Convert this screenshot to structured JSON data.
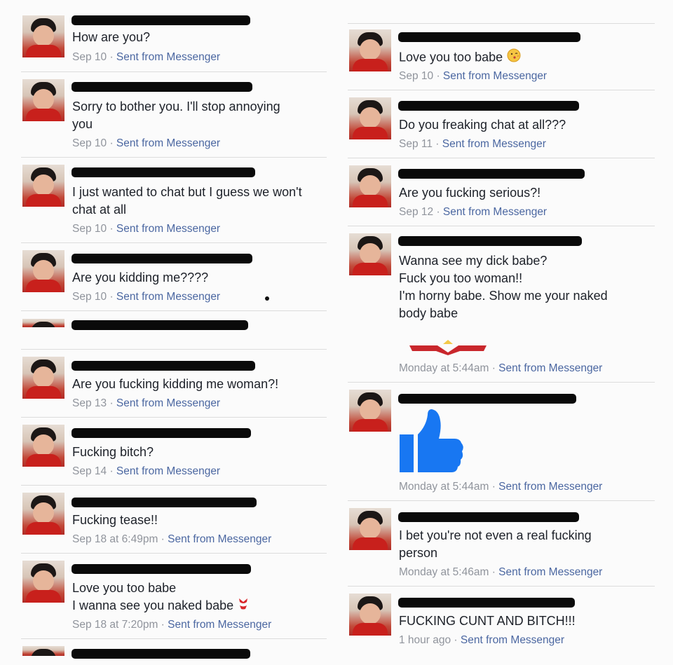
{
  "messages_left": [
    {
      "text": "How are you?",
      "date": "Sep 10",
      "sent_label": "Sent from Messenger"
    },
    {
      "text_lines": [
        "Sorry to bother you. I'll stop annoying",
        "you"
      ],
      "date": "Sep 10",
      "sent_label": "Sent from Messenger"
    },
    {
      "text_lines": [
        "I just wanted to chat but I guess we won't",
        "chat at all"
      ],
      "date": "Sep 10",
      "sent_label": "Sent from Messenger"
    },
    {
      "text": "Are you kidding me????",
      "date": "Sep 10",
      "sent_label": "Sent from Messenger"
    },
    {
      "text": "",
      "date": "",
      "sent_label": ""
    },
    {
      "text": "Are you fucking kidding me woman?!",
      "date": "Sep 13",
      "sent_label": "Sent from Messenger"
    },
    {
      "text": "Fucking bitch?",
      "date": "Sep 14",
      "sent_label": "Sent from Messenger"
    },
    {
      "text": "Fucking tease!!",
      "date": "Sep 18 at 6:49pm",
      "sent_label": "Sent from Messenger"
    },
    {
      "text_lines": [
        "Love you too babe",
        "I wanna see you naked babe"
      ],
      "date": "Sep 18 at 7:20pm",
      "sent_label": "Sent from Messenger",
      "emoji": "bikini-icon"
    }
  ],
  "messages_right": [
    {
      "text": "Love you too babe",
      "date": "Sep 10",
      "sent_label": "Sent from Messenger",
      "emoji": "kiss-face-icon"
    },
    {
      "text": "Do you freaking chat at all???",
      "date": "Sep 11",
      "sent_label": "Sent from Messenger"
    },
    {
      "text": "Are you fucking serious?!",
      "date": "Sep 12",
      "sent_label": "Sent from Messenger"
    },
    {
      "text_lines": [
        "Wanna see my dick babe?",
        "Fuck you too woman!!",
        "I'm horny babe. Show me your naked",
        "body babe"
      ],
      "date": "Monday at 5:44am",
      "sent_label": "Sent from Messenger"
    },
    {
      "sticker": "thumbs-up-icon",
      "date": "Monday at 5:44am",
      "sent_label": "Sent from Messenger"
    },
    {
      "text_lines": [
        "I bet you're not even a real fucking",
        "person"
      ],
      "date": "Monday at 5:46am",
      "sent_label": "Sent from Messenger"
    },
    {
      "text": "FUCKING CUNT AND BITCH!!!",
      "date": "1 hour ago",
      "sent_label": "Sent from Messenger"
    }
  ],
  "meta_separator": " · ",
  "colors": {
    "link": "#4b67a1",
    "meta": "#90949c",
    "like_blue": "#1877f2",
    "divider": "#dcdcdc"
  }
}
